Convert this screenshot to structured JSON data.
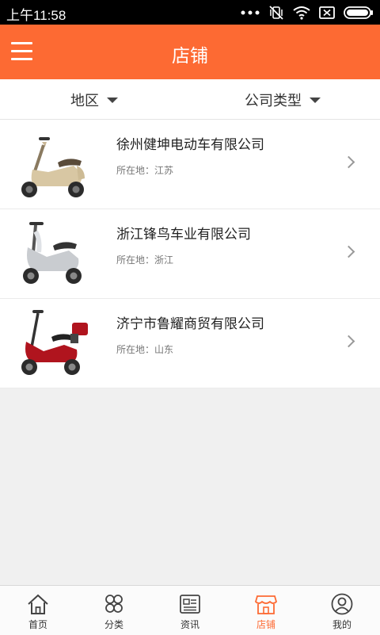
{
  "status_bar": {
    "time": "上午11:58"
  },
  "header": {
    "title": "店铺",
    "menu_icon": "hamburger-menu-icon"
  },
  "filters": [
    {
      "label": "地区"
    },
    {
      "label": "公司类型"
    }
  ],
  "shops": [
    {
      "name": "徐州健坤电动车有限公司",
      "location": "所在地：江苏",
      "image": "beige-scooter"
    },
    {
      "name": "浙江锋鸟车业有限公司",
      "location": "所在地：浙江",
      "image": "silver-scooter"
    },
    {
      "name": "济宁市鲁耀商贸有限公司",
      "location": "所在地：山东",
      "image": "red-scooter"
    }
  ],
  "tabs": [
    {
      "label": "首页",
      "icon": "home-icon"
    },
    {
      "label": "分类",
      "icon": "category-icon"
    },
    {
      "label": "资讯",
      "icon": "news-icon"
    },
    {
      "label": "店铺",
      "icon": "shop-icon",
      "active": true
    },
    {
      "label": "我的",
      "icon": "profile-icon"
    }
  ],
  "colors": {
    "accent": "#fd6a33",
    "status_bar": "#000000",
    "background": "#f0f0f0"
  }
}
